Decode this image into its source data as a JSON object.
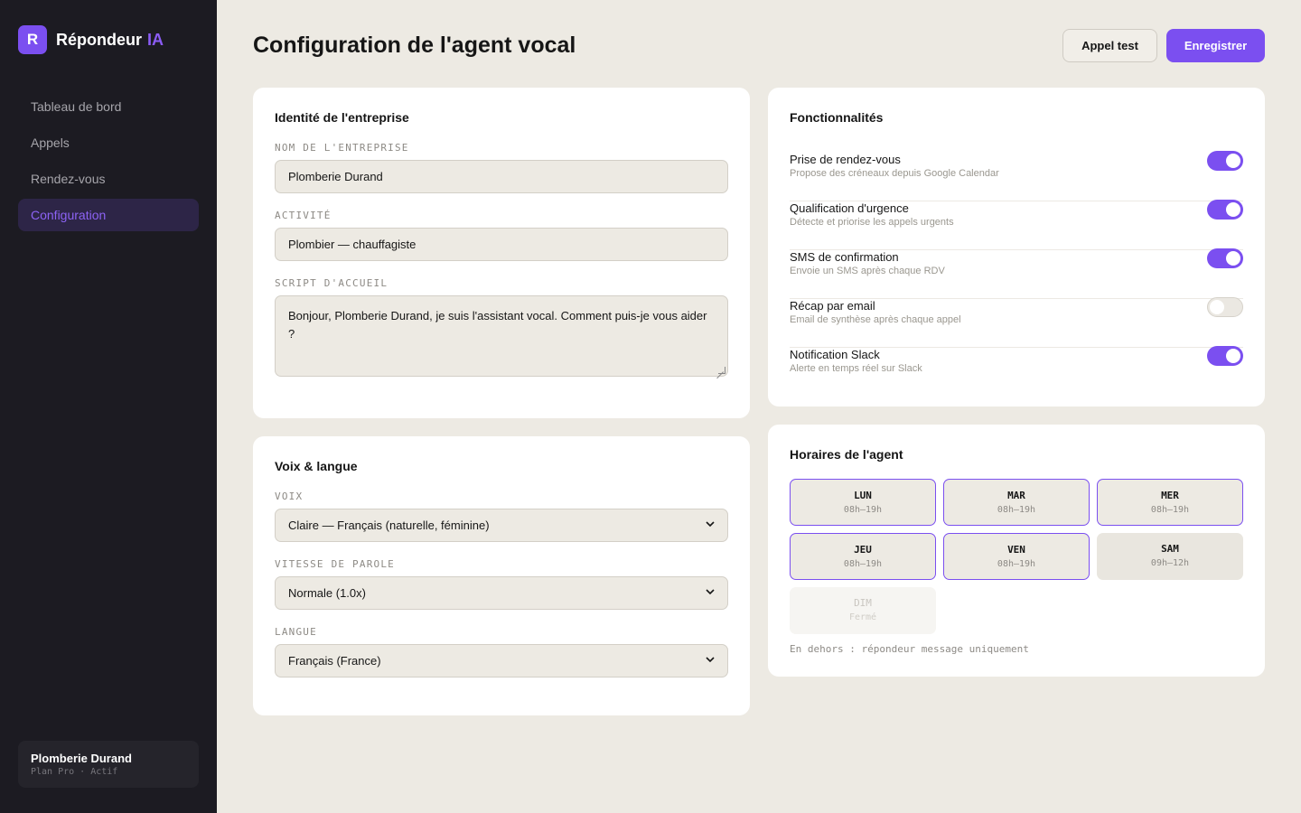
{
  "app": {
    "logo_letter": "R",
    "name": "Répondeur",
    "name_accent": "IA",
    "accent_color": "#7b4ff0"
  },
  "sidebar": {
    "items": [
      {
        "label": "Tableau de bord",
        "active": false
      },
      {
        "label": "Appels",
        "active": false
      },
      {
        "label": "Rendez-vous",
        "active": false
      },
      {
        "label": "Configuration",
        "active": true
      }
    ],
    "account": {
      "name": "Plomberie Durand",
      "plan": "Plan Pro · Actif"
    }
  },
  "header": {
    "title": "Configuration de l'agent vocal",
    "test_label": "Appel test",
    "save_label": "Enregistrer"
  },
  "identity": {
    "title": "Identité de l'entreprise",
    "company_label": "NOM DE L'ENTREPRISE",
    "company_value": "Plomberie Durand",
    "activity_label": "ACTIVITÉ",
    "activity_value": "Plombier — chauffagiste",
    "script_label": "SCRIPT D'ACCUEIL",
    "script_value": "Bonjour, Plomberie Durand, je suis l'assistant vocal. Comment puis-je vous aider ?"
  },
  "voice": {
    "title": "Voix & langue",
    "voice_label": "VOIX",
    "voice_value": "Claire — Français (naturelle, féminine)",
    "speed_label": "VITESSE DE PAROLE",
    "speed_value": "Normale (1.0x)",
    "lang_label": "LANGUE",
    "lang_value": "Français (France)"
  },
  "features": {
    "title": "Fonctionnalités",
    "items": [
      {
        "name": "Prise de rendez-vous",
        "desc": "Propose des créneaux depuis Google Calendar",
        "enabled": true
      },
      {
        "name": "Qualification d'urgence",
        "desc": "Détecte et priorise les appels urgents",
        "enabled": true
      },
      {
        "name": "SMS de confirmation",
        "desc": "Envoie un SMS après chaque RDV",
        "enabled": true
      },
      {
        "name": "Récap par email",
        "desc": "Email de synthèse après chaque appel",
        "enabled": false
      },
      {
        "name": "Notification Slack",
        "desc": "Alerte en temps réel sur Slack",
        "enabled": true
      }
    ]
  },
  "hours": {
    "title": "Horaires de l'agent",
    "days": [
      {
        "day": "LUN",
        "hours": "08h–19h",
        "state": "open"
      },
      {
        "day": "MAR",
        "hours": "08h–19h",
        "state": "open"
      },
      {
        "day": "MER",
        "hours": "08h–19h",
        "state": "open"
      },
      {
        "day": "JEU",
        "hours": "08h–19h",
        "state": "open"
      },
      {
        "day": "VEN",
        "hours": "08h–19h",
        "state": "open"
      },
      {
        "day": "SAM",
        "hours": "09h–12h",
        "state": "partial"
      },
      {
        "day": "DIM",
        "hours": "Fermé",
        "state": "closed"
      }
    ],
    "note": "En dehors : répondeur message uniquement"
  }
}
